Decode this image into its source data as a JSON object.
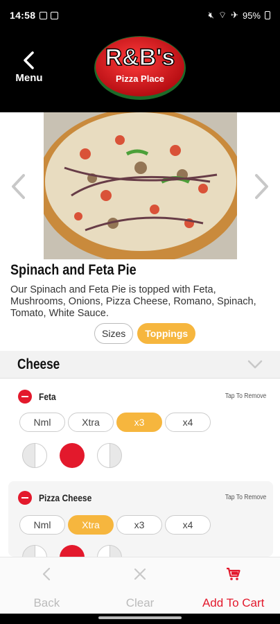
{
  "status": {
    "time": "14:58",
    "battery": "95%"
  },
  "header": {
    "back_label": "Menu",
    "logo_main": "R&B's",
    "logo_sub": "Pizza Place"
  },
  "product": {
    "title": "Spinach and Feta Pie",
    "description": "Our Spinach and Feta Pie is topped with Feta, Mushrooms, Onions, Pizza Cheese, Romano, Spinach, Tomato, White Sauce."
  },
  "tabs": [
    {
      "label": "Sizes",
      "active": false
    },
    {
      "label": "Toppings",
      "active": true
    }
  ],
  "group": {
    "title": "Cheese"
  },
  "toppings": [
    {
      "name": "Feta",
      "remove_hint": "Tap To Remove",
      "amounts": [
        "Nml",
        "Xtra",
        "x3",
        "x4"
      ],
      "selected_amount": "x3",
      "placement": "whole"
    },
    {
      "name": "Pizza Cheese",
      "remove_hint": "Tap To Remove",
      "amounts": [
        "Nml",
        "Xtra",
        "x3",
        "x4"
      ],
      "selected_amount": "Xtra",
      "placement": "whole"
    }
  ],
  "bottom": {
    "back": "Back",
    "clear": "Clear",
    "add_to_cart": "Add To Cart"
  },
  "colors": {
    "accent": "#f6b63e",
    "brand_red": "#e3192c"
  }
}
